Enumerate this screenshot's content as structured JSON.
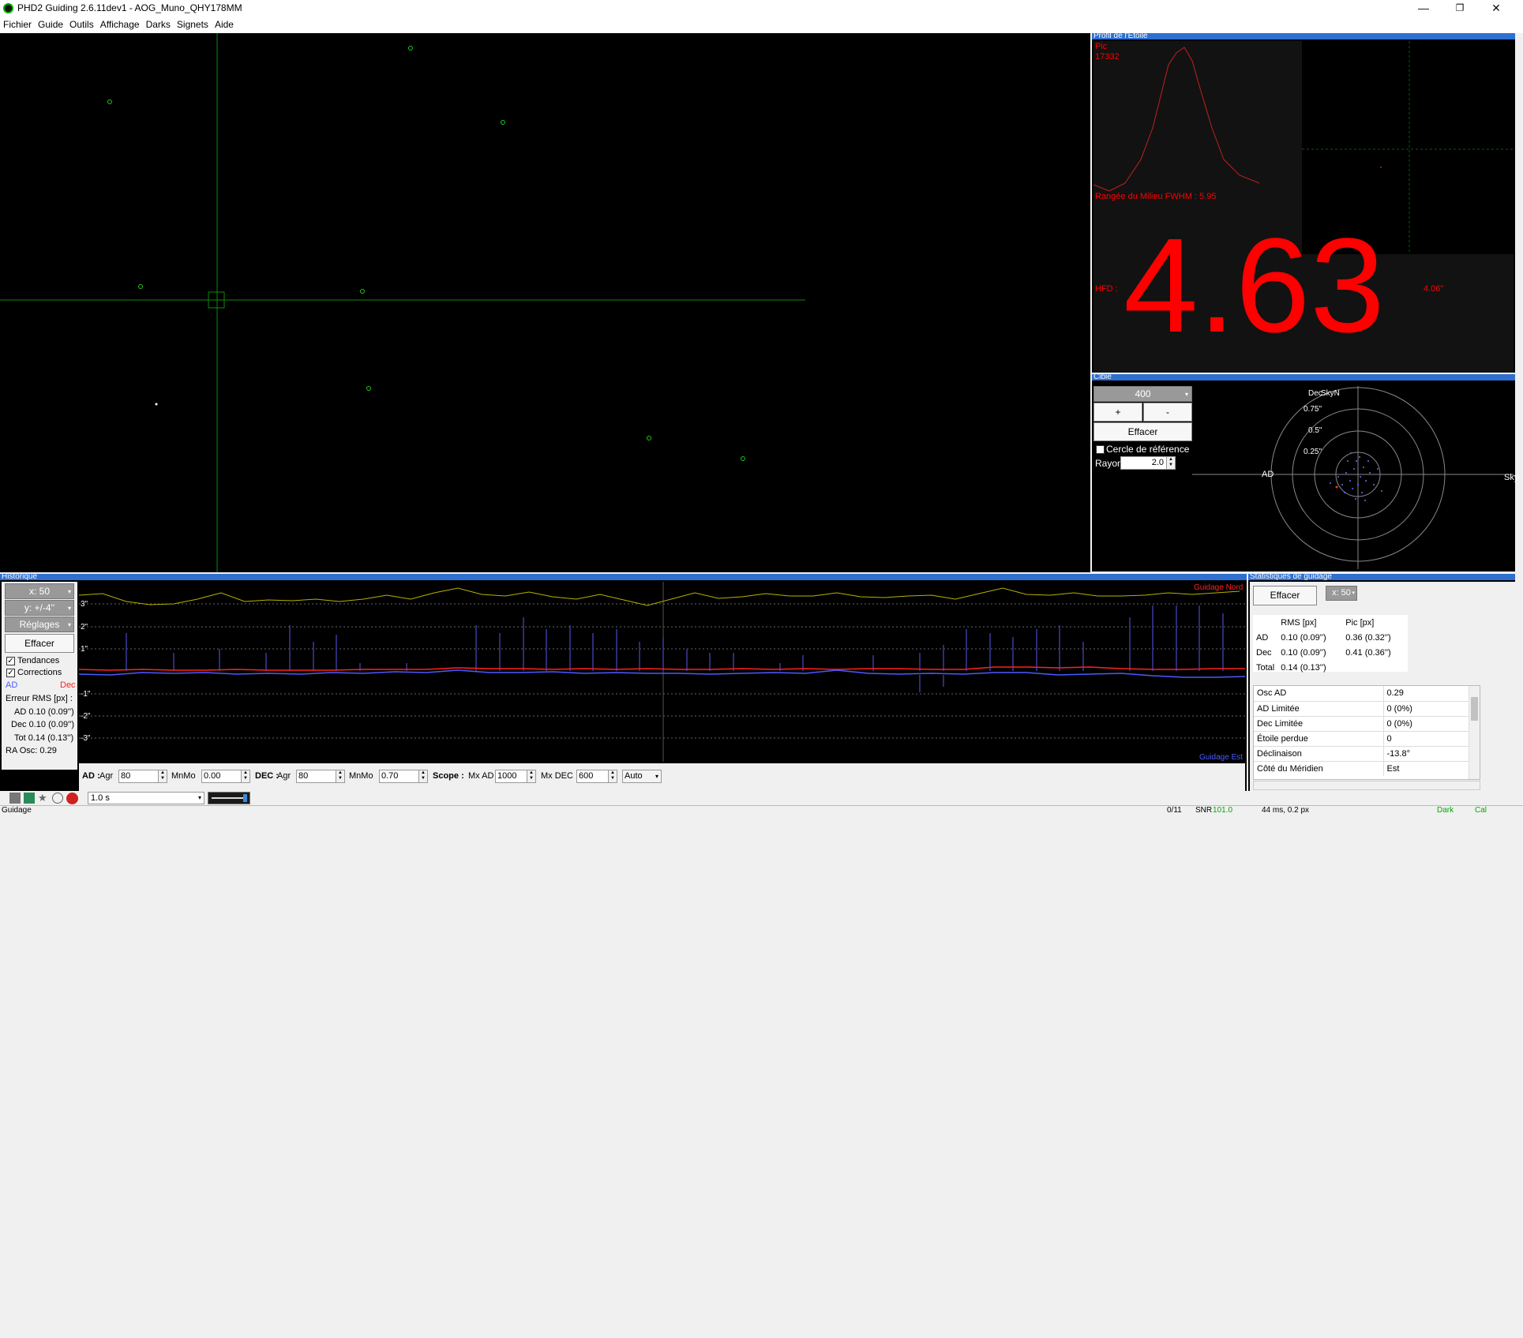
{
  "window": {
    "title": "PHD2 Guiding 2.6.11dev1 - AOG_Muno_QHY178MM",
    "minimize": "—",
    "restore": "❐",
    "close": "✕"
  },
  "menu": [
    "Fichier",
    "Guide",
    "Outils",
    "Affichage",
    "Darks",
    "Signets",
    "Aide"
  ],
  "panels": {
    "profile": "Profil de l'Etoile",
    "target": "Cible",
    "history": "Historique",
    "stats": "Statistiques de guidage"
  },
  "profile": {
    "peak_label": "Pic",
    "peak_value": "17332",
    "fwhm": "Rangée du Milieu FWHM : 5.95",
    "hfd_label": "HFD :",
    "hfd_value": "4.63",
    "hfd_arcsec": "4.06\""
  },
  "target": {
    "scale_value": "400",
    "plus": "+",
    "minus": "-",
    "clear": "Effacer",
    "ref_circle": "Cercle de référence",
    "radius_label": "Rayon:",
    "radius_value": "2.0",
    "ring_labels": [
      "0.75\"",
      "0.5\"",
      "0.25\""
    ],
    "axis_dec": "Dec",
    "axis_skyn": "SkyN",
    "axis_ad": "AD",
    "axis_sky": "Sky"
  },
  "history": {
    "x_scale": "x: 50",
    "y_scale": "y: +/-4''",
    "settings": "Réglages",
    "clear": "Effacer",
    "trends": "Tendances",
    "corrections": "Corrections",
    "legend_ad": "AD",
    "legend_dec": "Dec",
    "rms_title": "Erreur RMS [px] :",
    "rms_ad": "AD 0.10 (0.09'')",
    "rms_dec": "Dec 0.10 (0.09'')",
    "rms_tot": "Tot 0.14 (0.13'')",
    "ra_osc": "RA Osc: 0.29",
    "y_labels": [
      "3\"",
      "2\"",
      "1\"",
      "-1\"",
      "-2\"",
      "-3\""
    ],
    "guide_north": "Guidage Nord",
    "guide_east": "Guidage Est",
    "colors": {
      "ra": "#4a5aff",
      "dec": "#ff2020",
      "snr": "#b8b000"
    }
  },
  "controls": {
    "ad_label": "AD :",
    "agr_label": "Agr",
    "ad_agr": "80",
    "mnmo_label": "MnMo",
    "ad_mnmo": "0.00",
    "dec_label": "DEC :",
    "dec_agr": "80",
    "dec_mnmo": "0.70",
    "scope_label": "Scope :",
    "mx_ad_label": "Mx AD",
    "mx_ad": "1000",
    "mx_dec_label": "Mx DEC",
    "mx_dec": "600",
    "mode": "Auto"
  },
  "stats": {
    "clear": "Effacer",
    "x_scale": "x: 50",
    "headers": [
      "",
      "RMS [px]",
      "Pic [px]"
    ],
    "rows": [
      [
        "AD",
        "0.10 (0.09'')",
        "0.36 (0.32'')"
      ],
      [
        "Dec",
        "0.10 (0.09'')",
        "0.41 (0.36'')"
      ],
      [
        "Total",
        "0.14 (0.13'')",
        ""
      ]
    ],
    "info": [
      [
        "Osc AD",
        "0.29"
      ],
      [
        "AD Limitée",
        "0 (0%)"
      ],
      [
        "Dec Limitée",
        "0 (0%)"
      ],
      [
        "Étoile perdue",
        "0"
      ],
      [
        "Déclinaison",
        "-13.8°"
      ],
      [
        "Côté du Méridien",
        "Est"
      ]
    ]
  },
  "toolbar": {
    "exposure": "1.0 s"
  },
  "status": {
    "text": "Guidage",
    "frames": "0/11",
    "snr": "SNR",
    "snr_value": "101.0",
    "timing": "44 ms, 0.2 px",
    "dark": "Dark",
    "cal": "Cal"
  }
}
